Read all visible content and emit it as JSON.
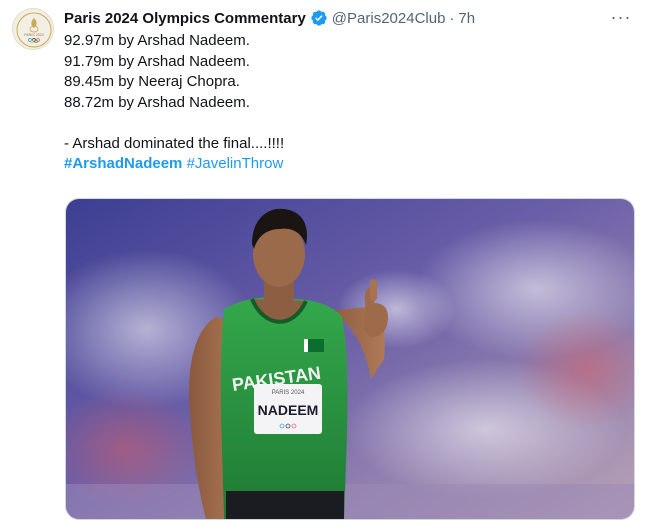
{
  "tweet": {
    "author_name": "Paris 2024 Olympics Commentary",
    "handle": "@Paris2024Club",
    "separator": "·",
    "time": "7h",
    "more_label": "···",
    "lines": [
      "92.97m by Arshad Nadeem.",
      "91.79m by Arshad Nadeem.",
      "89.45m by Neeraj Chopra.",
      "88.72m by Arshad Nadeem."
    ],
    "closing": "- Arshad dominated the final....!!!!",
    "hashtags": [
      "#ArshadNadeem",
      "#JavelinThrow"
    ],
    "avatar_text": "PARIS 2024",
    "image": {
      "jersey_country": "PAKISTAN",
      "jersey_event": "PARIS 2024",
      "bib_name": "NADEEM"
    }
  },
  "colors": {
    "link": "#1d9bf0",
    "verified": "#1d9bf0",
    "jersey_green": "#2e9a44"
  }
}
